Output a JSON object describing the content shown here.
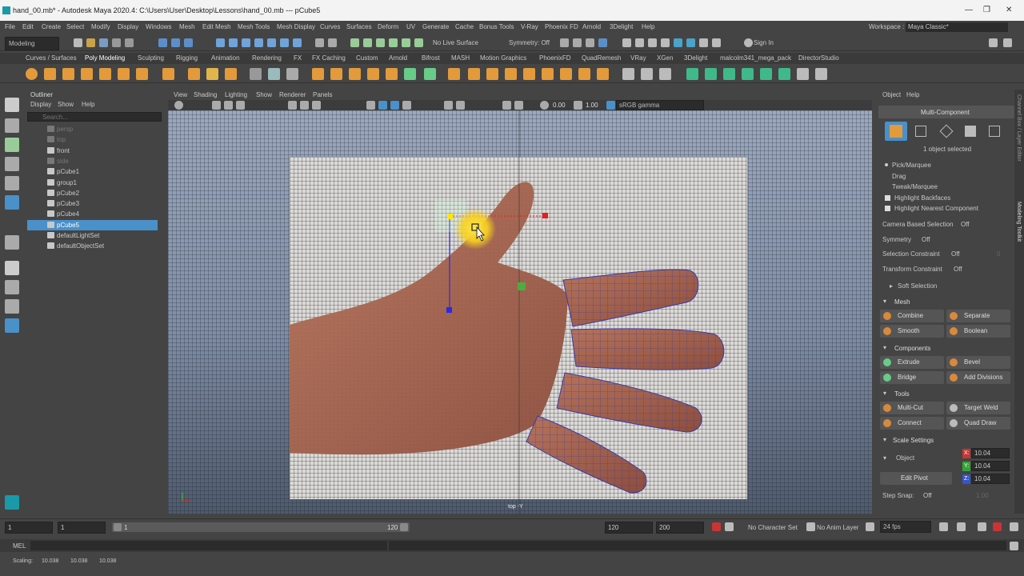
{
  "window": {
    "title": "hand_00.mb* - Autodesk Maya 2020.4: C:\\Users\\User\\Desktop\\Lessons\\hand_00.mb   ---   pCube5",
    "controls": [
      "—",
      "❐",
      "✕"
    ]
  },
  "menubar": {
    "items": [
      "File",
      "Edit",
      "Create",
      "Select",
      "Modify",
      "Display",
      "Windows",
      "Mesh",
      "Edit Mesh",
      "Mesh Tools",
      "Mesh Display",
      "Curves",
      "Surfaces",
      "Deform",
      "UV",
      "Generate",
      "Cache",
      "Bonus Tools",
      "V-Ray",
      "Phoenix FD",
      "Arnold",
      "3Delight",
      "Help"
    ],
    "workspace_label": "Workspace :",
    "workspace_value": "Maya Classic*"
  },
  "statusline": {
    "mode": "Modeling",
    "live_surface": "No Live Surface",
    "symmetry": "Symmetry: Off",
    "sign_in": "Sign In"
  },
  "shelf_tabs": [
    "Curves / Surfaces",
    "Poly Modeling",
    "Sculpting",
    "Rigging",
    "Animation",
    "Rendering",
    "FX",
    "FX Caching",
    "Custom",
    "Arnold",
    "Bifrost",
    "MASH",
    "Motion Graphics",
    "PhoenixFD",
    "QuadRemesh",
    "VRay",
    "XGen",
    "3Delight",
    "malcolm341_mega_pack",
    "DirectorStudio"
  ],
  "shelf_active": "Poly Modeling",
  "outliner": {
    "title": "Outliner",
    "menu": [
      "Display",
      "Show",
      "Help"
    ],
    "search_placeholder": "Search...",
    "items": [
      {
        "label": "persp",
        "dim": true
      },
      {
        "label": "top",
        "dim": true
      },
      {
        "label": "front",
        "dim": false
      },
      {
        "label": "side",
        "dim": true
      },
      {
        "label": "pCube1",
        "dim": false
      },
      {
        "label": "group1",
        "dim": false
      },
      {
        "label": "pCube2",
        "dim": false
      },
      {
        "label": "pCube3",
        "dim": false
      },
      {
        "label": "pCube4",
        "dim": false
      },
      {
        "label": "pCube5",
        "dim": false,
        "selected": true
      },
      {
        "label": "defaultLightSet",
        "dim": false
      },
      {
        "label": "defaultObjectSet",
        "dim": false
      }
    ]
  },
  "viewport": {
    "menu": [
      "View",
      "Shading",
      "Lighting",
      "Show",
      "Renderer",
      "Panels"
    ],
    "exposure": "0.00",
    "gamma": "1.00",
    "color_space": "sRGB gamma",
    "camera_label": "top -Y"
  },
  "modeling_toolkit": {
    "menu": [
      "Object",
      "Help"
    ],
    "title": "Multi-Component",
    "selected_count": "1 object selected",
    "pick_options": [
      "Pick/Marquee",
      "Drag",
      "Tweak/Marquee"
    ],
    "checks": [
      "Highlight Backfaces",
      "Highlight Nearest Component"
    ],
    "camera_based_selection": "Camera Based Selection",
    "camera_based_value": "Off",
    "symmetry": "Symmetry",
    "symmetry_value": "Off",
    "selection_constraint": "Selection Constraint",
    "selection_constraint_value": "Off",
    "selection_constraint_num": "0",
    "transform_constraint": "Transform Constraint",
    "transform_constraint_value": "Off",
    "soft_selection": "Soft Selection",
    "sections": {
      "mesh": "Mesh",
      "components": "Components",
      "tools": "Tools",
      "scale": "Scale Settings"
    },
    "mesh_buttons": [
      "Combine",
      "Separate",
      "Smooth",
      "Boolean"
    ],
    "component_buttons": [
      "Extrude",
      "Bevel",
      "Bridge",
      "Add Divisions"
    ],
    "tool_buttons": [
      "Multi-Cut",
      "Target Weld",
      "Connect",
      "Quad Draw"
    ],
    "scale_mode": "Object",
    "scale_x": "10.04",
    "scale_y": "10.04",
    "scale_z": "10.04",
    "x_label": "X:",
    "y_label": "Y:",
    "z_label": "Z:",
    "edit_pivot": "Edit Pivot",
    "step_snap": "Step Snap:",
    "step_snap_value": "Off",
    "step_snap_num": "1.00",
    "side_tabs": [
      "Channel Box / Layer Editor",
      "Modeling Toolkit"
    ]
  },
  "timeline": {
    "start": "1",
    "current": "1",
    "range_start": "1",
    "range_end": "120",
    "end": "120",
    "max": "200",
    "character_set": "No Character Set",
    "anim_layer": "No Anim Layer",
    "fps": "24 fps"
  },
  "command_line": {
    "label": "MEL"
  },
  "help_line": {
    "label": "Scaling:",
    "values": [
      "10.038",
      "10.038",
      "10.038"
    ]
  },
  "colors": {
    "selection": "#4a90c9",
    "accent_orange": "#d9893c",
    "manip_x": "#e32020",
    "manip_y": "#3fb93f",
    "manip_z": "#2a2ae6"
  }
}
